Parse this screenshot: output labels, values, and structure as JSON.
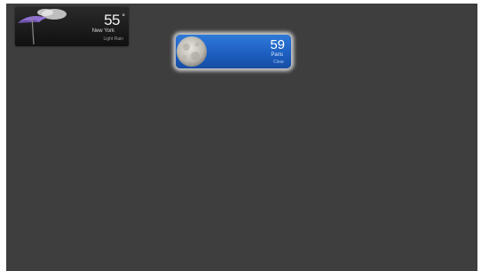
{
  "widgets": {
    "dark": {
      "temperature": "55",
      "degree_symbol": "°",
      "location": "New York",
      "condition": "Light Rain",
      "icon": "umbrella-icon"
    },
    "blue": {
      "temperature": "59",
      "location": "Paris",
      "condition": "Clear",
      "icon": "moon-icon"
    }
  },
  "colors": {
    "desktop_background": "#3e3e3e",
    "blue_widget": "#1d5fc2",
    "umbrella": "#8f6fd0"
  }
}
